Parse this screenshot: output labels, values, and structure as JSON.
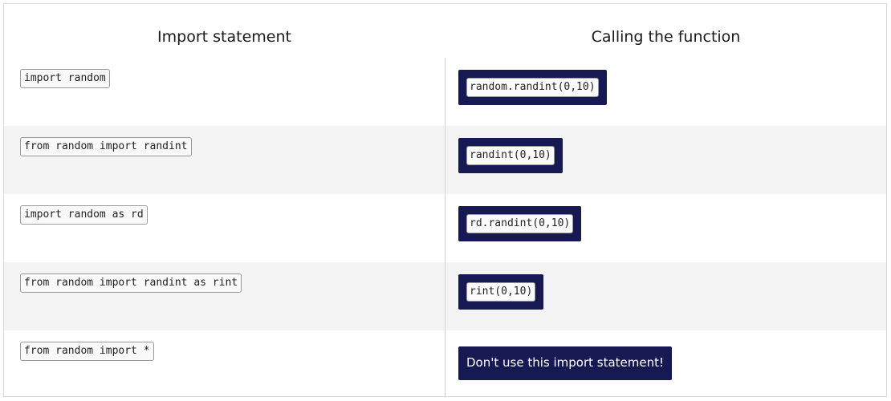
{
  "table": {
    "headers": {
      "import": "Import statement",
      "calling": "Calling the function"
    },
    "rows": [
      {
        "import": "import random",
        "call": "random.randint(0,10)",
        "shaded": false
      },
      {
        "import": "from random import randint",
        "call": "randint(0,10)",
        "shaded": true
      },
      {
        "import": "import random as rd",
        "call": "rd.randint(0,10)",
        "shaded": false
      },
      {
        "import": "from random import randint as rint",
        "call": "rint(0,10)",
        "shaded": true
      },
      {
        "import": "from random import *",
        "warning": "Don't use this import statement!",
        "shaded": false
      }
    ]
  },
  "colors": {
    "call_box_bg": "#171a52",
    "shaded_row_bg": "#f4f4f4"
  }
}
